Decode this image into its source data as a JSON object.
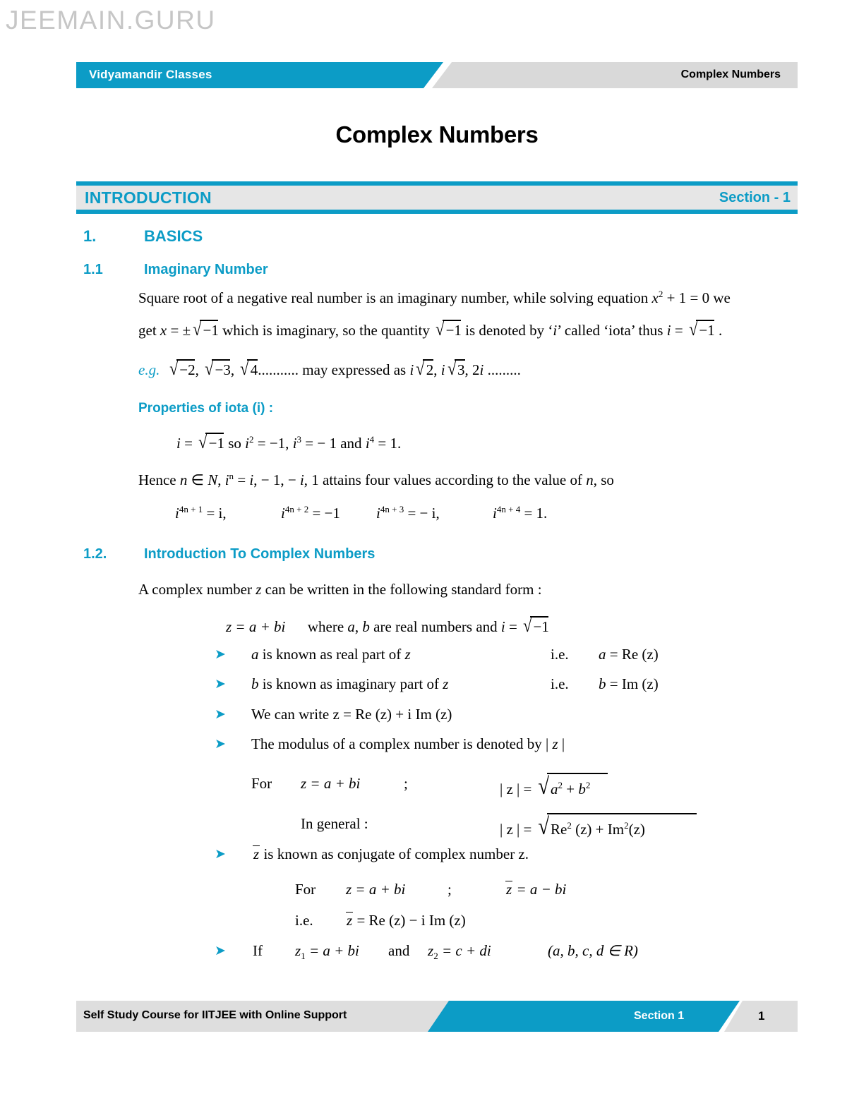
{
  "watermark": "JEEMAIN.GURU",
  "header": {
    "left_label": "Vidyamandir Classes",
    "right_label": "Complex Numbers"
  },
  "chapter_title": "Complex Numbers",
  "section_band": {
    "name": "INTRODUCTION",
    "number": "Section - 1"
  },
  "headings": {
    "h1_num": "1.",
    "h1_text": "BASICS",
    "h11_num": "1.1",
    "h11_text": "Imaginary Number",
    "h12_num": "1.2.",
    "h12_text": "Introduction To Complex Numbers",
    "properties_label": "Properties of iota (i) :"
  },
  "body": {
    "p1_line1_a": "Square root of a negative real number is an imaginary number, while solving equation ",
    "p1_line1_x": "x",
    "p1_line1_sup": "2",
    "p1_line1_b": " + 1 = 0 we",
    "p1_line2_a": "get ",
    "p1_line2_x": "x",
    "p1_line2_b": " = ±",
    "p1_line2_rad1": "−1",
    "p1_line2_c": " which is imaginary, so the quantity ",
    "p1_line2_rad2": "−1",
    "p1_line2_d": " is denoted by ‘",
    "p1_line2_i": "i",
    "p1_line2_e": "’ called ‘iota’ thus ",
    "p1_line2_i2": "i",
    "p1_line2_f": " = ",
    "p1_line2_rad3": "−1",
    "p1_line2_g": " .",
    "eg_label": "e.g.",
    "eg_r1": "−2",
    "eg_c1": ", ",
    "eg_r2": "−3",
    "eg_c2": ", ",
    "eg_r3": "4",
    "eg_dots1": "...........",
    "eg_mid": " may expressed as ",
    "eg_i1": "i",
    "eg_r4": "2",
    "eg_c3": ", ",
    "eg_i2": "i",
    "eg_r5": "3",
    "eg_c4": ",  2",
    "eg_i3": "i",
    "eg_dots2": " .........",
    "prop_i": "i",
    "prop_eq": " = ",
    "prop_rad": "−1",
    "prop_rest_a": " so ",
    "prop_i2": "i",
    "prop_sup2": "2",
    "prop_rest_b": " = −1, ",
    "prop_i3": "i",
    "prop_sup3": "3",
    "prop_rest_c": " = − 1 and ",
    "prop_i4": "i",
    "prop_sup4": "4",
    "prop_rest_d": " = 1.",
    "hence_a": "Hence ",
    "hence_n": "n",
    "hence_b": " ∈ ",
    "hence_N": "N",
    "hence_c": ", ",
    "hence_i": "i",
    "hence_supn": "n",
    "hence_d": " = ",
    "hence_i2": "i",
    "hence_e": ", − 1, − ",
    "hence_i3": "i",
    "hence_f": ", 1 attains four values according to the value of ",
    "hence_n2": "n",
    "hence_g": ", so",
    "pow_1_base": "i",
    "pow_1_sup": "4n + 1",
    "pow_1_val": " = i,",
    "pow_2_base": "i",
    "pow_2_sup": "4n + 2",
    "pow_2_val": " = −1",
    "pow_3_base": "i",
    "pow_3_sup": "4n + 3",
    "pow_3_val": " = − i,",
    "pow_4_base": "i",
    "pow_4_sup": "4n + 4",
    "pow_4_val": " = 1.",
    "p2_line1_a": "A complex number ",
    "p2_line1_z": "z",
    "p2_line1_b": " can be written in the following standard form :",
    "std_form_a": "z = a + bi",
    "std_form_b": "where ",
    "std_form_c": "a",
    "std_form_d": ", ",
    "std_form_e": "b",
    "std_form_f": " are real numbers and ",
    "std_form_i": "i",
    "std_form_g": " = ",
    "std_form_rad": "−1"
  },
  "bullets": {
    "glyph": "➤",
    "b1_a": "a",
    "b1_b": " is known as real part of ",
    "b1_z": "z",
    "b1_ie": "i.e.",
    "b1_res_a": "a",
    "b1_res_b": " = Re (z)",
    "b2_a": "b",
    "b2_b": " is known as imaginary part of ",
    "b2_z": "z",
    "b2_ie": "i.e.",
    "b2_res_a": "b",
    "b2_res_b": " = Im (z)",
    "b3": "We can write z = Re (z) + i Im (z)",
    "b4_a": "The modulus of a complex number is denoted by | ",
    "b4_z": "z",
    "b4_b": " |",
    "for_label": "For",
    "for_expr": "z = a + bi",
    "semi": ";",
    "mod1_lhs": "| z | = ",
    "mod1_a": "a",
    "mod1_a_sup": "2",
    "mod1_plus": " + ",
    "mod1_b": "b",
    "mod1_b_sup": "2",
    "ingen_label": "In general :",
    "mod2_lhs": "| z | = ",
    "mod2_re": "Re",
    "mod2_re_sup": "2",
    "mod2_rez": " (z)",
    "mod2_plus": " + ",
    "mod2_im": "Im",
    "mod2_im_sup": "2",
    "mod2_imz": "(z)",
    "b5_zbar": "z",
    "b5_text": " is known as conjugate of complex number z.",
    "b5_for": "For",
    "b5_expr": "z = a + bi",
    "b5_semi": ";",
    "b5_conj_bar": "z",
    "b5_conj_rest": " = a − bi",
    "b5_ie": "i.e.",
    "b5_ie_bar": "z",
    "b5_ie_rest": " = Re (z) − i Im (z)",
    "b6_if": "If",
    "b6_z1": "z",
    "b6_z1_sub": "1",
    "b6_z1_rest": " = a + bi",
    "b6_and": "and",
    "b6_z2": "z",
    "b6_z2_sub": "2",
    "b6_z2_rest": " = c + di",
    "b6_cond": "(a, b, c, d ∈ R)"
  },
  "footer": {
    "left": "Self Study Course for IITJEE with Online Support",
    "center": "Section 1",
    "page": "1"
  },
  "colors": {
    "accent": "#0c9cc6",
    "band_bg": "#e6e6e6",
    "header_grey": "#d9d9d9",
    "footer_grey": "#dedede",
    "watermark": "#c6c6c6"
  }
}
